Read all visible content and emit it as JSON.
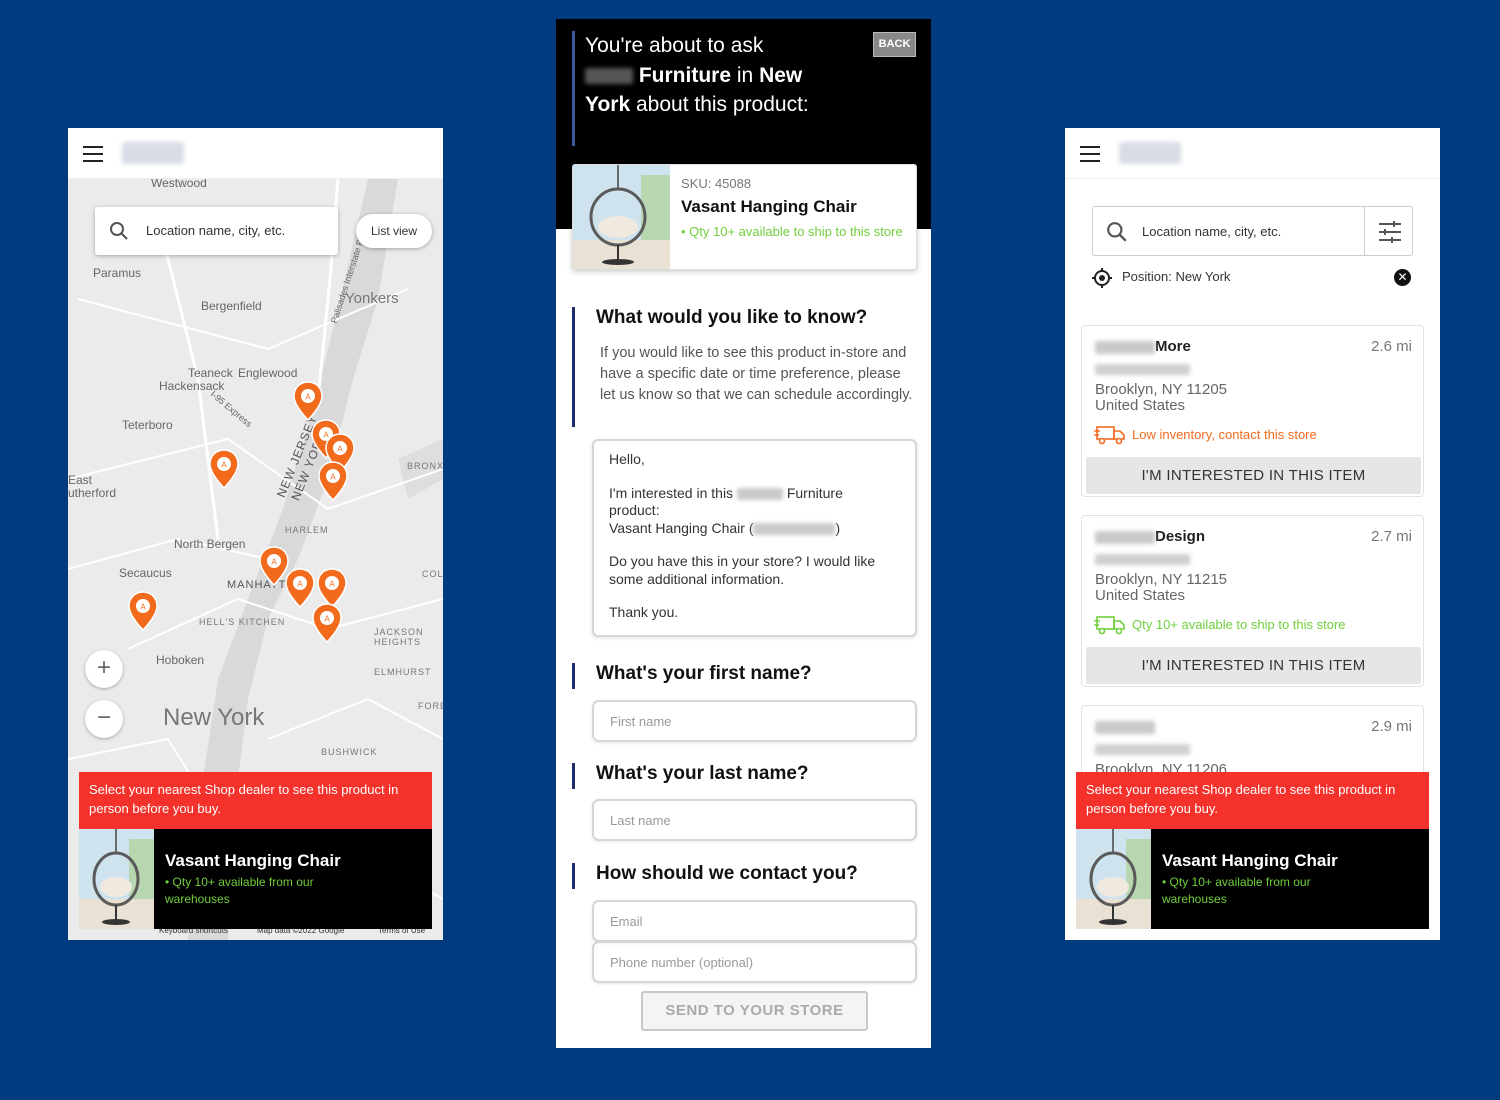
{
  "product": {
    "name": "Vasant Hanging Chair",
    "sku_label": "SKU: 45088",
    "card_availability": "• Qty 10+ available to ship to this store",
    "banner_availability": "• Qty 10+ available from our warehouses"
  },
  "banner": {
    "message": "Select your nearest Shop dealer to see this product in person before you buy."
  },
  "map_screen": {
    "search_placeholder": "Location name, city, etc.",
    "list_view_label": "List view",
    "zoom_in": "+",
    "zoom_out": "−",
    "labels": {
      "westwood": "Westwood",
      "paramus": "Paramus",
      "bergenfield": "Bergenfield",
      "yonkers": "Yonkers",
      "teaneck": "Teaneck",
      "englewood": "Englewood",
      "hackensack": "Hackensack",
      "teterboro": "Teterboro",
      "east_rutherford": "East\nutherford",
      "new_jersey": "NEW JERSEY",
      "new_york_state": "NEW YORK",
      "bronx": "BRONX",
      "harlem": "HARLEM",
      "north_bergen": "North Bergen",
      "secaucus": "Secaucus",
      "manhattan": "MANHATTAN",
      "hells_kitchen": "HELL'S KITCHEN",
      "hoboken": "Hoboken",
      "jackson_heights": "JACKSON\nHEIGHTS",
      "elmhurst": "ELMHURST",
      "new_york_city": "New York",
      "bushwick": "BUSHWICK",
      "i95_express": "I-95 Express",
      "palisades": "Palisades Interstate Pkwy",
      "fore": "FORE",
      "col": "COL"
    },
    "attribution": {
      "shortcuts": "Keyboard shortcuts",
      "map_data": "Map data ©2022 Google",
      "terms": "Terms of Use"
    }
  },
  "form_screen": {
    "ask_prefix": "You're about to ask",
    "store_brand_suffix": "Furniture",
    "ask_in": "in",
    "city": "New York",
    "ask_suffix": "about this product:",
    "back_label": "BACK",
    "q_know": "What would you like to know?",
    "q_know_help": "If you would like to see this product in-store and have a specific date or time preference, please let us know so that we can schedule accordingly.",
    "message": {
      "greeting": "Hello,",
      "line1_a": "I'm interested in this",
      "line1_b": "Furniture",
      "line1_c": "product:",
      "line2_a": "Vasant Hanging Chair (",
      "line2_b": ")",
      "line3": "Do you have this in your store? I would like some additional information.",
      "thanks": "Thank you."
    },
    "q_first": "What's your first name?",
    "first_placeholder": "First name",
    "q_last": "What's your last name?",
    "last_placeholder": "Last name",
    "q_contact": "How should we contact you?",
    "email_placeholder": "Email",
    "phone_placeholder": "Phone number (optional)",
    "send_label": "SEND TO YOUR STORE"
  },
  "list_screen": {
    "search_placeholder": "Location name, city, etc.",
    "position_label": "Position: New York",
    "clear_label": "✕",
    "interest_label": "I'M INTERESTED IN THIS ITEM",
    "stores": [
      {
        "name": "More",
        "distance": "2.6 mi",
        "city": "Brooklyn, NY 11205",
        "country": "United States",
        "status": "Low inventory, contact this store",
        "status_color": "#f26b1d"
      },
      {
        "name": "Design",
        "distance": "2.7 mi",
        "city": "Brooklyn, NY 11215",
        "country": "United States",
        "status": "Qty 10+ available to ship to this store",
        "status_color": "#6fcf3c"
      },
      {
        "name": "",
        "distance": "2.9 mi",
        "city": "Brooklyn, NY 11206",
        "country": "",
        "status": "",
        "status_color": "#6fcf3c"
      }
    ]
  },
  "colors": {
    "background": "#003b80",
    "banner_red": "#f4312a",
    "pin_orange": "#f26b1d",
    "available_green": "#6fcf3c"
  }
}
